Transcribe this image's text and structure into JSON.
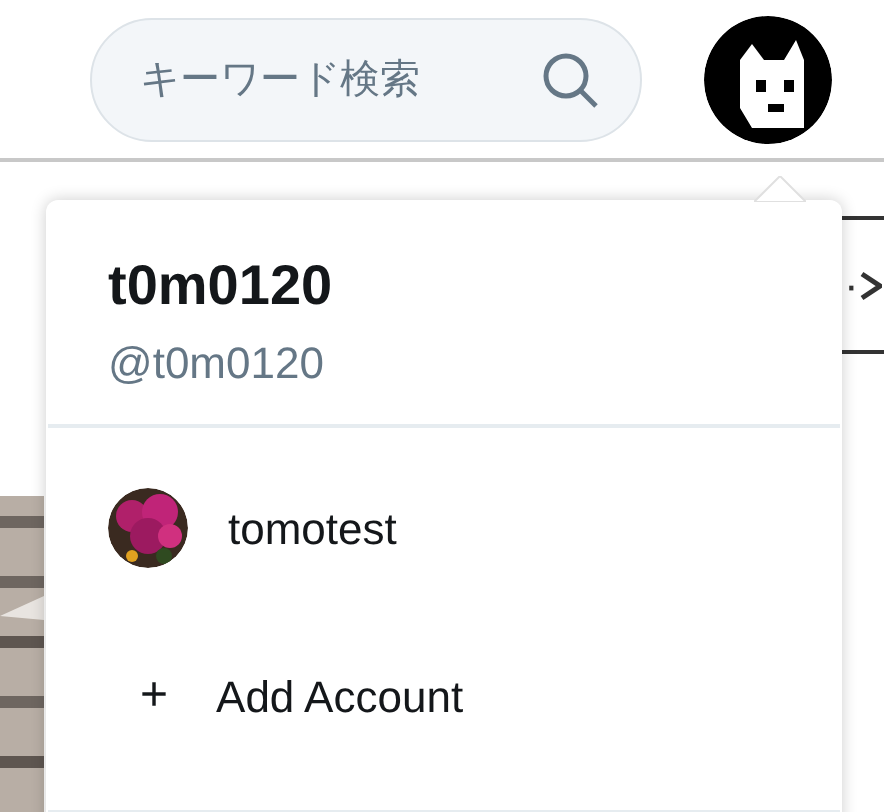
{
  "search": {
    "placeholder": "キーワード検索"
  },
  "background_button": {
    "label": "·"
  },
  "menu": {
    "display_name": "t0m0120",
    "handle": "@t0m0120",
    "items": [
      {
        "kind": "account",
        "label": "tomotest"
      },
      {
        "kind": "add",
        "icon": "+",
        "label": "Add Account"
      }
    ]
  }
}
